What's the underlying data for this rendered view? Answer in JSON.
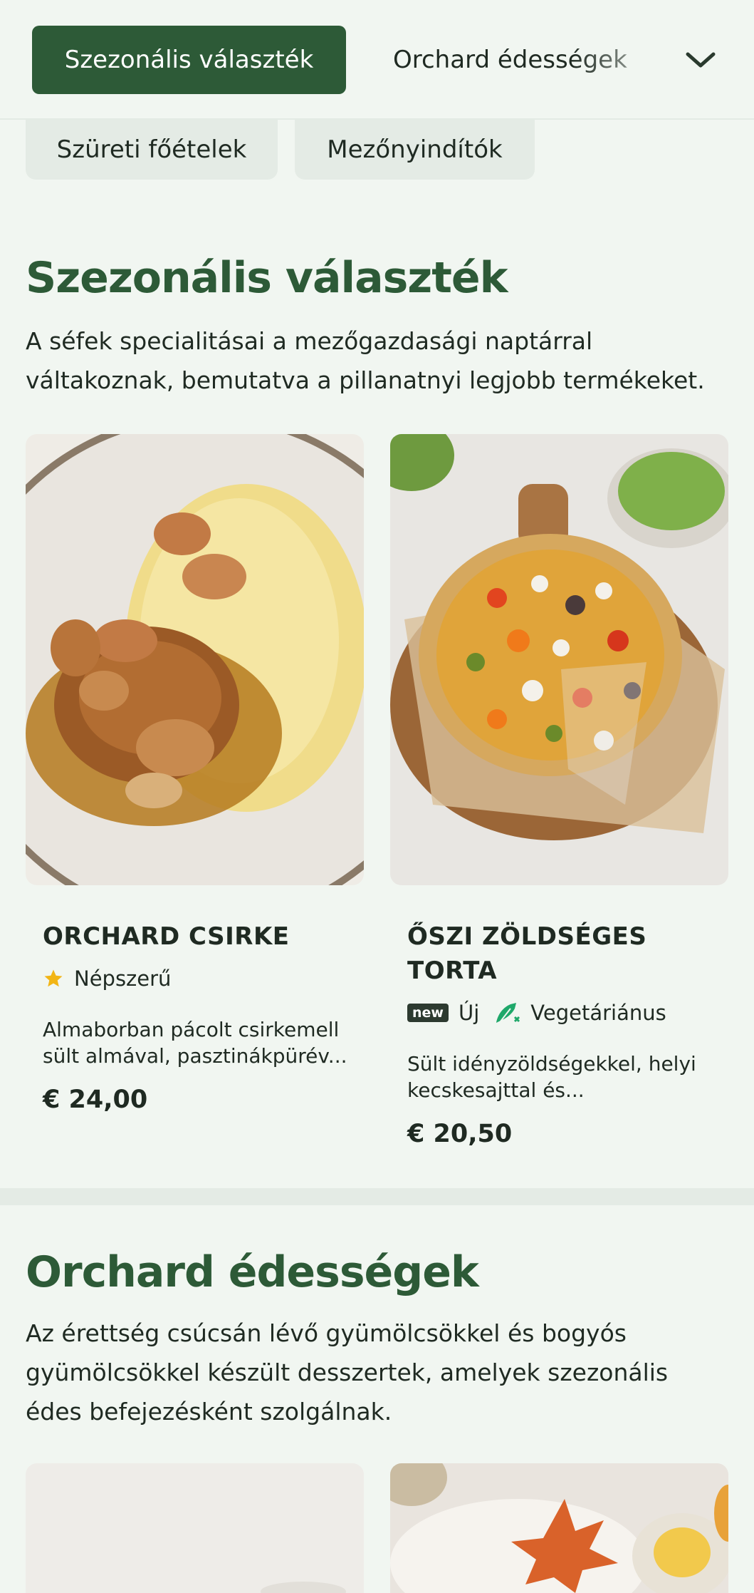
{
  "nav": {
    "active_tab": "Szezonális választék",
    "next_tab": "Orchard édességek",
    "chip_1": "Szüreti főételek",
    "chip_2": "Mezőnyindítók"
  },
  "seasonal": {
    "title": "Szezonális választék",
    "description": "A séfek specialitásai a mezőgazdasági naptárral váltakoznak, bemutatva a pillanatnyi legjobb termékeket.",
    "items": [
      {
        "name": "ORCHARD CSIRKE",
        "badges": [
          "Népszerű"
        ],
        "description_line1": "Almaborban pácolt csirkemell",
        "description_line2": "sült almával, pasztinákpürév...",
        "price": "€ 24,00"
      },
      {
        "name_line1": "ŐSZI ZÖLDSÉGES",
        "name_line2": "TORTA",
        "new_badge": "new",
        "badge_new_label": "Új",
        "badge_veg_label": "Vegetáriánus",
        "description_line1": "Sült idényzöldségekkel, helyi",
        "description_line2": "kecskesajttal és...",
        "price": "€ 20,50"
      }
    ]
  },
  "sweets": {
    "title": "Orchard édességek",
    "description": "Az érettség csúcsán lévő gyümölcsökkel és bogyós gyümölcsökkel készült desszertek, amelyek szezonális édes befejezésként szolgálnak."
  },
  "colors": {
    "brand_green": "#2d5a37",
    "background": "#f1f6f1",
    "chip": "#e4ebe5",
    "star": "#f2b515",
    "veg_icon": "#1fa86a"
  },
  "icons": [
    "chevron-down-icon",
    "star-icon",
    "vegetarian-icon"
  ]
}
